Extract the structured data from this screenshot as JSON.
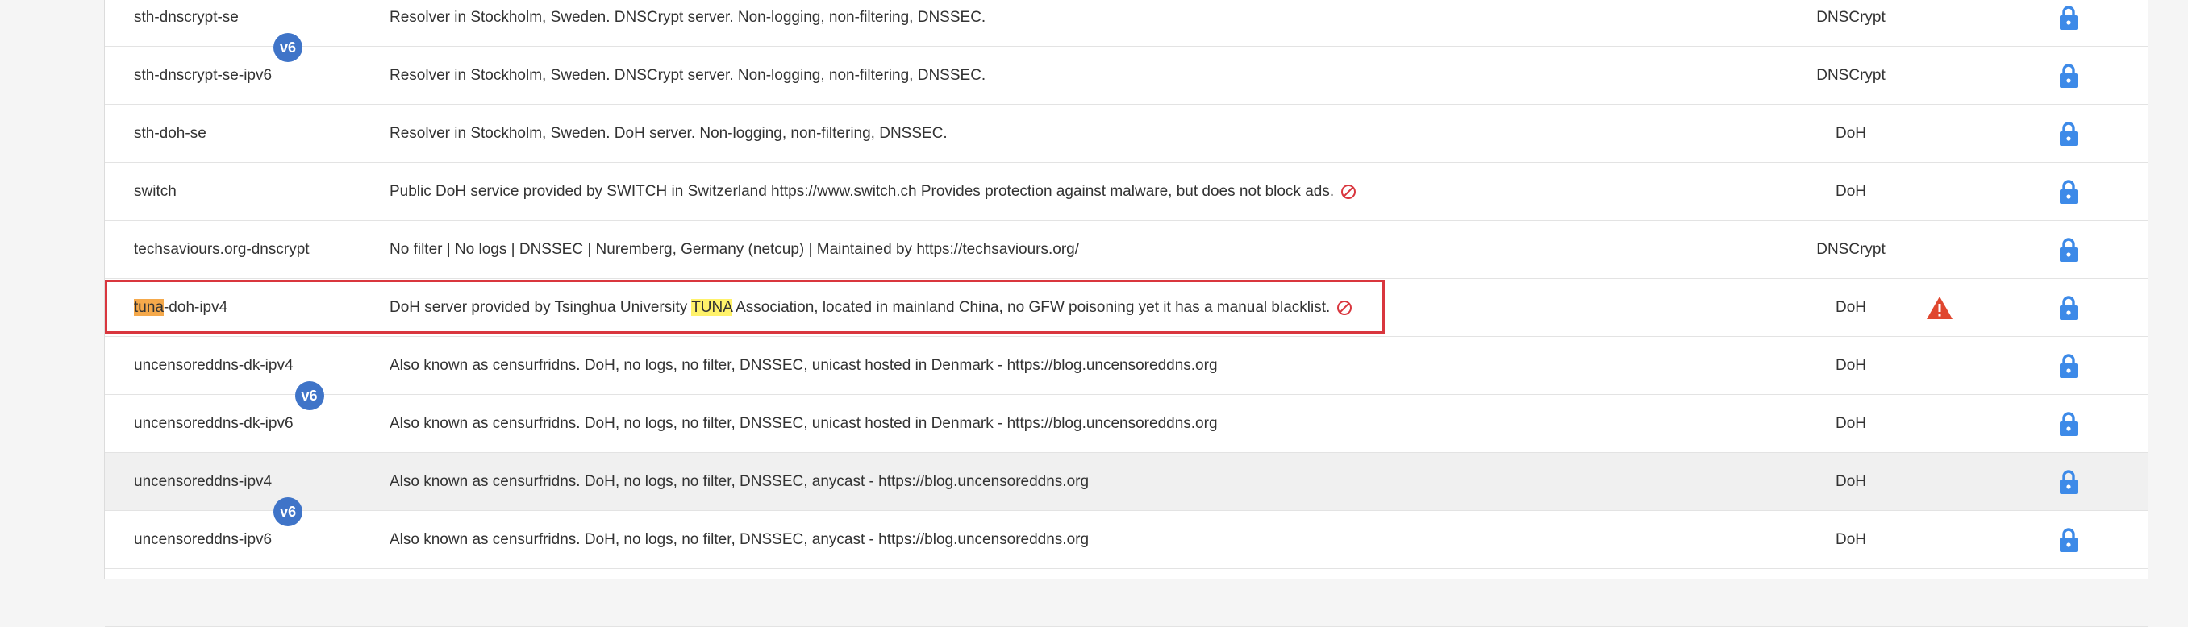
{
  "resolvers": [
    {
      "name": "sth-dnscrypt-se",
      "ipv6": false,
      "description": "Resolver in Stockholm, Sweden. DNSCrypt server. Non-logging, non-filtering, DNSSEC.",
      "protocol": "DNSCrypt",
      "blocked_icon": false,
      "warning": false,
      "lock_icon": "lock-icon"
    },
    {
      "name": "sth-dnscrypt-se-ipv6",
      "ipv6": true,
      "v6_badge": "v6",
      "description": "Resolver in Stockholm, Sweden. DNSCrypt server. Non-logging, non-filtering, DNSSEC.",
      "protocol": "DNSCrypt",
      "blocked_icon": false,
      "warning": false,
      "lock_icon": "lock-icon"
    },
    {
      "name": "sth-doh-se",
      "ipv6": false,
      "description": "Resolver in Stockholm, Sweden. DoH server. Non-logging, non-filtering, DNSSEC.",
      "protocol": "DoH",
      "blocked_icon": false,
      "warning": false,
      "lock_icon": "lock-icon"
    },
    {
      "name": "switch",
      "ipv6": false,
      "description": "Public DoH service provided by SWITCH in Switzerland https://www.switch.ch Provides protection against malware, but does not block ads.",
      "protocol": "DoH",
      "blocked_icon": true,
      "warning": false,
      "lock_icon": "lock-icon"
    },
    {
      "name": "techsaviours.org-dnscrypt",
      "ipv6": false,
      "description": "No filter | No logs | DNSSEC | Nuremberg, Germany (netcup) | Maintained by https://techsaviours.org/",
      "protocol": "DNSCrypt",
      "blocked_icon": false,
      "warning": false,
      "lock_icon": "lock-icon"
    },
    {
      "name_highlight": "tuna",
      "name_rest": "-doh-ipv4",
      "ipv6": false,
      "desc_before": "DoH server provided by Tsinghua University ",
      "desc_highlight": "TUNA",
      "desc_after": " Association, located in mainland China, no GFW poisoning yet it has a manual blacklist.",
      "protocol": "DoH",
      "blocked_icon": true,
      "warning": true,
      "warning_icon": "warning-icon",
      "lock_icon": "lock-icon"
    },
    {
      "name": "uncensoreddns-dk-ipv4",
      "ipv6": false,
      "description": "Also known as censurfridns. DoH, no logs, no filter, DNSSEC, unicast hosted in Denmark - https://blog.uncensoreddns.org",
      "protocol": "DoH",
      "blocked_icon": false,
      "warning": false,
      "lock_icon": "lock-icon"
    },
    {
      "name": "uncensoreddns-dk-ipv6",
      "ipv6": true,
      "v6_badge": "v6",
      "description": "Also known as censurfridns. DoH, no logs, no filter, DNSSEC, unicast hosted in Denmark - https://blog.uncensoreddns.org",
      "protocol": "DoH",
      "blocked_icon": false,
      "warning": false,
      "lock_icon": "lock-icon"
    },
    {
      "name": "uncensoreddns-ipv4",
      "ipv6": false,
      "description": "Also known as censurfridns. DoH, no logs, no filter, DNSSEC, anycast - https://blog.uncensoreddns.org",
      "protocol": "DoH",
      "blocked_icon": false,
      "warning": false,
      "hovered": true,
      "lock_icon": "lock-icon"
    },
    {
      "name": "uncensoreddns-ipv6",
      "ipv6": true,
      "v6_badge": "v6",
      "description": "Also known as censurfridns. DoH, no logs, no filter, DNSSEC, anycast - https://blog.uncensoreddns.org",
      "protocol": "DoH",
      "blocked_icon": false,
      "warning": false,
      "lock_icon": "lock-icon"
    }
  ],
  "colors": {
    "lock": "#3d8ae8",
    "v6_badge": "#3f74c8",
    "warning": "#e0472f",
    "blocked": "#d9363e",
    "highlight_name": "#f5a94b",
    "highlight_desc": "#fff26a",
    "selection_outline": "#d9363e"
  }
}
